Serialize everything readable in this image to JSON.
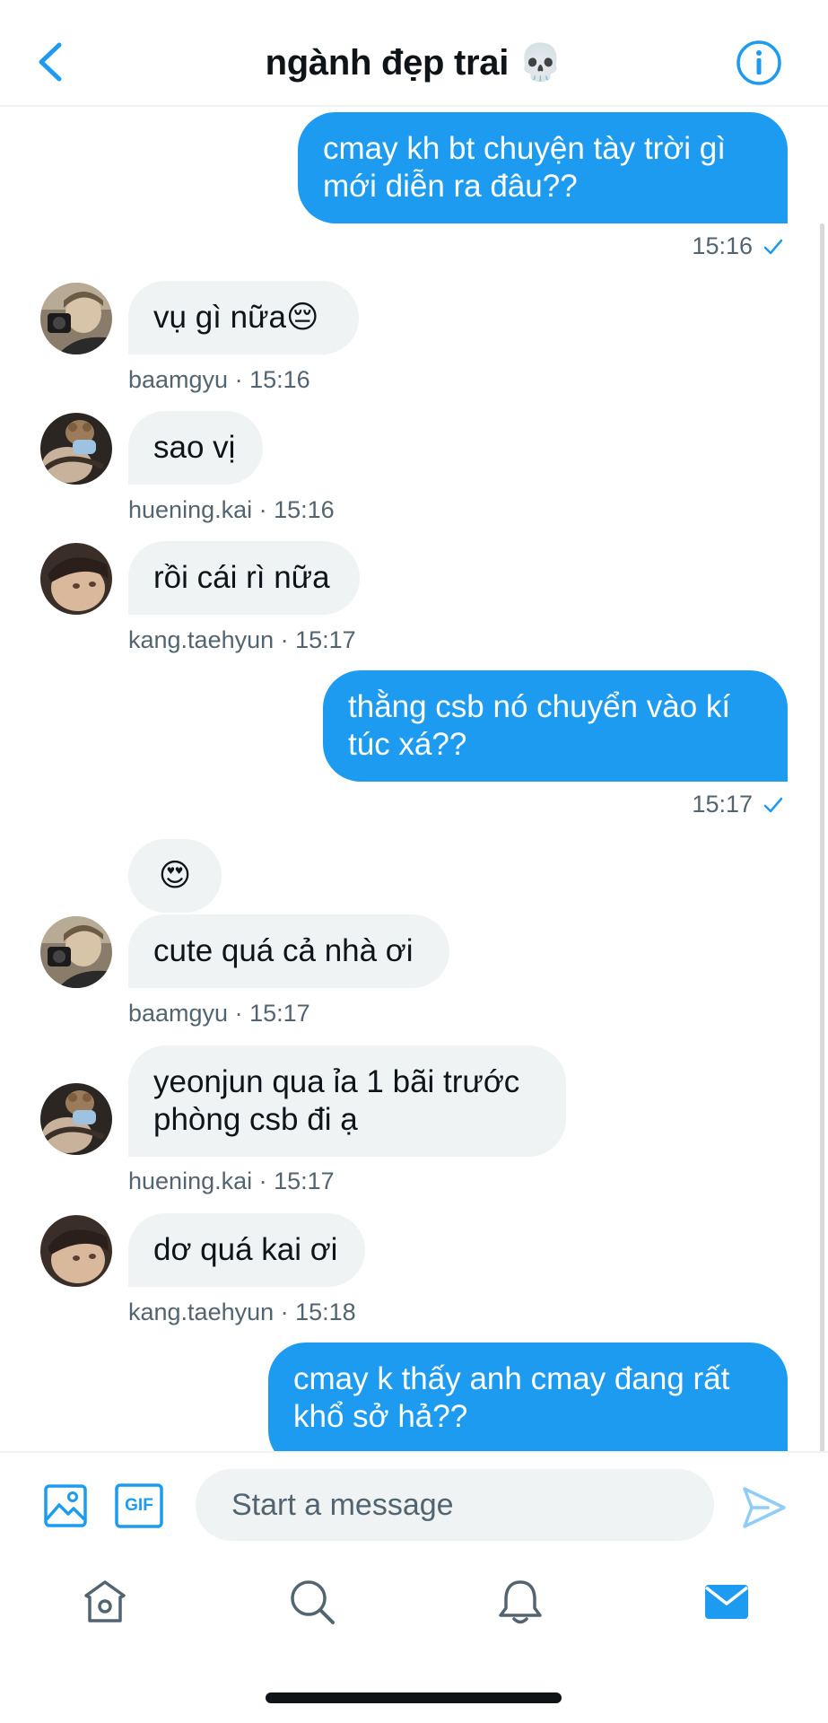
{
  "header": {
    "title": "ngành đẹp trai 💀"
  },
  "messages": [
    {
      "text": "cmay kh bt chuyện tày trời gì\nmới diễn ra đâu??",
      "time": "15:16"
    },
    {
      "text": "vụ gì nữa😔",
      "meta": "baamgyu · 15:16"
    },
    {
      "text": "sao vị",
      "meta": "huening.kai · 15:16"
    },
    {
      "text": "rồi cái rì nữa",
      "meta": "kang.taehyun · 15:17"
    },
    {
      "text": "thằng csb nó chuyển vào kí\ntúc xá??",
      "time": "15:17"
    },
    {
      "text": "😍"
    },
    {
      "text": "cute quá cả nhà ơi",
      "meta": "baamgyu · 15:17"
    },
    {
      "text": "yeonjun qua ỉa 1 bãi trước\nphòng csb đi ạ",
      "meta": "huening.kai · 15:17"
    },
    {
      "text": "dơ quá kai ơi",
      "meta": "kang.taehyun · 15:18"
    },
    {
      "text": "cmay k thấy anh cmay đang rất\nkhổ sở hả??"
    }
  ],
  "composer": {
    "placeholder": "Start a message",
    "gif_label": "GIF"
  },
  "colors": {
    "accent": "#1d9bf0",
    "incoming_bubble": "#eff3f4",
    "meta_text": "#536471"
  },
  "icons": {
    "back": "chevron-left-icon",
    "info": "info-icon",
    "media": "image-icon",
    "send": "send-icon",
    "home": "home-icon",
    "search": "search-icon",
    "notifications": "bell-icon",
    "messages": "mail-icon"
  }
}
